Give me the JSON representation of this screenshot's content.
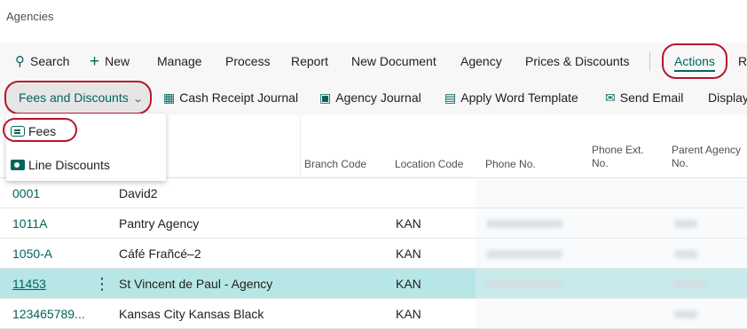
{
  "page": {
    "title": "Agencies"
  },
  "action_bar": {
    "items": [
      {
        "label": "Search",
        "icon": "search-icon"
      },
      {
        "label": "New",
        "icon": "plus-icon"
      },
      {
        "label": "Manage"
      },
      {
        "label": "Process"
      },
      {
        "label": "Report"
      },
      {
        "label": "New Document"
      },
      {
        "label": "Agency"
      },
      {
        "label": "Prices & Discounts"
      },
      {
        "label": "Actions",
        "active": true
      },
      {
        "label": "Re"
      }
    ]
  },
  "sub_bar": {
    "fees_and_discounts": "Fees and Discounts",
    "items": [
      {
        "label": "Cash Receipt Journal",
        "icon": "journal-icon"
      },
      {
        "label": "Agency Journal",
        "icon": "agency-journal-icon"
      },
      {
        "label": "Apply Word Template",
        "icon": "word-template-icon"
      },
      {
        "label": "Send Email",
        "icon": "email-icon"
      },
      {
        "label": "Display"
      }
    ]
  },
  "dropdown": {
    "items": [
      {
        "label": "Fees",
        "icon": "fees-icon"
      },
      {
        "label": "Line Discounts",
        "icon": "line-discounts-icon"
      }
    ]
  },
  "table": {
    "columns": {
      "branch_code": "Branch Code",
      "location_code": "Location Code",
      "phone_no": "Phone No.",
      "phone_ext_1": "Phone Ext.",
      "phone_ext_2": "No.",
      "parent_agency_1": "Parent Agency",
      "parent_agency_2": "No."
    },
    "rows": [
      {
        "no": "0001",
        "name": "David2",
        "location": "",
        "selected": false
      },
      {
        "no": "1011A",
        "name": "Pantry Agency",
        "location": "KAN",
        "selected": false
      },
      {
        "no": "1050-A",
        "name": "Cáfé Frañcé–2",
        "location": "KAN",
        "selected": false
      },
      {
        "no": "11453",
        "name": "St Vincent de Paul - Agency",
        "location": "KAN",
        "selected": true
      },
      {
        "no": "123465789...",
        "name": "Kansas City Kansas Black",
        "location": "KAN",
        "selected": false
      }
    ]
  },
  "colors": {
    "accent": "#00655a",
    "highlight_ring": "#b7152b",
    "selected_row": "#b7e6e6"
  }
}
